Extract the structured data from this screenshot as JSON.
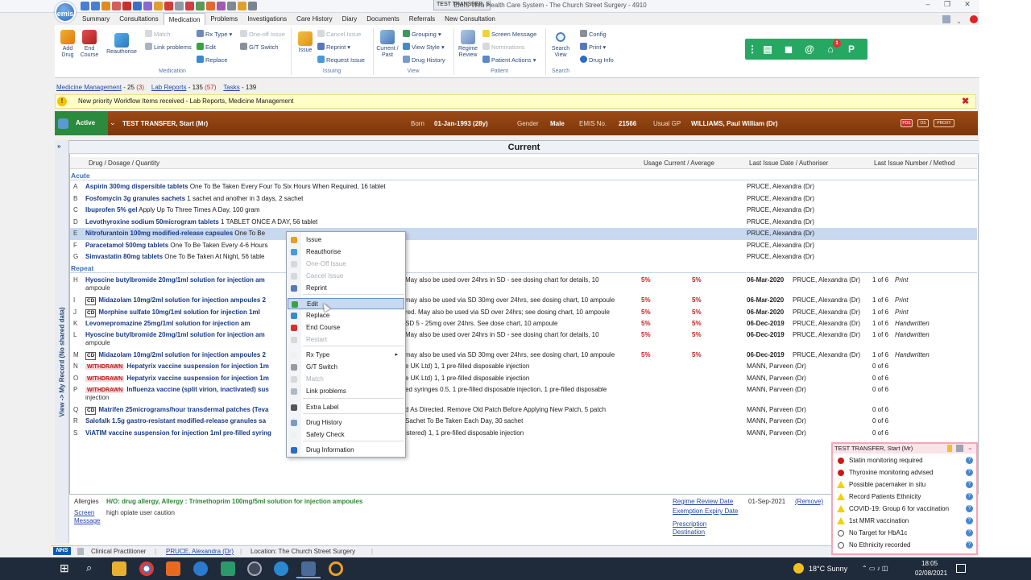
{
  "window": {
    "title": "EMIS Web Health Care System - The Church Street Surgery - 4910",
    "doc_tab": "TEST TRANSFER, St...",
    "logo": "emis",
    "min": "–",
    "max": "❐",
    "close": "✕"
  },
  "ribbon_tabs": [
    "Summary",
    "Consultations",
    "Medication",
    "Problems",
    "Investigations",
    "Care History",
    "Diary",
    "Documents",
    "Referrals",
    "New Consultation"
  ],
  "ribbon": {
    "add_drug": "Add Drug",
    "end_course": "End Course",
    "reauthorise": "Reauthorise",
    "match": "Match",
    "link_problems": "Link problems",
    "rx_type": "Rx Type",
    "edit": "Edit",
    "replace": "Replace",
    "one_off_issue": "One-off Issue",
    "gt_switch": "G/T Switch",
    "group_medication": "Medication",
    "issue": "Issue",
    "cancel_issue": "Cancel Issue",
    "reprint": "Reprint",
    "request_issue": "Request Issue",
    "group_issuing": "Issuing",
    "current_past": "Current / Past",
    "grouping": "Grouping",
    "view_style": "View Style",
    "drug_history": "Drug History",
    "group_view": "View",
    "regime_review": "Regime Review",
    "screen_message": "Screen Message",
    "nominations": "Nominations",
    "patient_actions": "Patient Actions",
    "group_patient": "Patient",
    "search_view": "Search View",
    "config": "Config",
    "print": "Print",
    "drug_info": "Drug Info",
    "group_search": "Search"
  },
  "greenbar": {
    "badge": "1",
    "p": "P"
  },
  "status": {
    "medicine_management": "Medicine Management",
    "mm_count": "- 25",
    "mm_new": "(3)",
    "lab_reports": "Lab Reports",
    "lr_count": "- 135",
    "lr_new": "(57)",
    "tasks": "Tasks",
    "tasks_count": "- 139"
  },
  "notification": {
    "text": "New priority Workflow Items received - Lab Reports, Medicine Management",
    "icon": "!",
    "close": "✖"
  },
  "patient": {
    "status": "Active",
    "name": "TEST TRANSFER, Start (Mr)",
    "born_label": "Born",
    "born": "01-Jan-1993 (28y)",
    "gender_label": "Gender",
    "gender": "Male",
    "emis_label": "EMIS No.",
    "emis_no": "21566",
    "gp_label": "Usual GP",
    "gp": "WILLIAMS, Paul William (Dr)",
    "badges": [
      "PDS",
      "OS",
      "PROXY"
    ]
  },
  "main": {
    "title": "Current",
    "side_label": "View -> My Record (No shared data)",
    "side_arrow": "»",
    "columns": {
      "drug": "Drug / Dosage / Quantity",
      "usage": "Usage Current / Average",
      "last_issue": "Last Issue Date / Authoriser",
      "last_num": "Last Issue Number / Method"
    },
    "sections": {
      "acute": "Acute",
      "repeat": "Repeat"
    },
    "acute": [
      {
        "l": "A",
        "d": "Aspirin 300mg dispersible tablets",
        "s": " One To Be Taken Every Four To Six Hours When Required, 16 tablet",
        "auth": "PRUCE, Alexandra (Dr)"
      },
      {
        "l": "B",
        "d": "Fosfomycin 3g granules sachets",
        "s": " 1 sachet and another in 3 days, 2 sachet",
        "auth": "PRUCE, Alexandra (Dr)"
      },
      {
        "l": "C",
        "d": "Ibuprofen 5% gel",
        "s": " Apply Up To Three Times A Day, 100 gram",
        "auth": "PRUCE, Alexandra (Dr)"
      },
      {
        "l": "D",
        "d": "Levothyroxine sodium 50microgram tablets",
        "s": " 1 TABLET ONCE A DAY, 56 tablet",
        "auth": "PRUCE, Alexandra (Dr)"
      },
      {
        "l": "E",
        "d": "Nitrofurantoin 100mg modified-release capsules",
        "s": " One To Be",
        "auth": "PRUCE, Alexandra (Dr)"
      },
      {
        "l": "F",
        "d": "Paracetamol 500mg tablets",
        "s": " One To Be Taken Every 4-6 Hours",
        "auth": "PRUCE, Alexandra (Dr)"
      },
      {
        "l": "G",
        "d": "Simvastatin 80mg tablets",
        "s": " One To Be Taken At Night, 56 table",
        "auth": "PRUCE, Alexandra (Dr)"
      }
    ],
    "repeat": [
      {
        "l": "H",
        "d": "Hyoscine butylbromide 20mg/1ml solution for injection am",
        "r": "May also be used over 24hrs in SD - see dosing chart for details, 10",
        "cont": "ampoule",
        "u": "5%",
        "a": "5%",
        "date": "06-Mar-2020",
        "auth": "PRUCE, Alexandra (Dr)",
        "num": "1 of 6",
        "meth": "Print"
      },
      {
        "l": "I",
        "cd": "CD",
        "d": "Midazolam 10mg/2ml solution for injection ampoules 2",
        "r": "may also be used via SD 30mg over 24hrs, see dosing chart, 10 ampoule",
        "u": "5%",
        "a": "5%",
        "date": "06-Mar-2020",
        "auth": "PRUCE, Alexandra (Dr)",
        "num": "1 of 6",
        "meth": "Print"
      },
      {
        "l": "J",
        "cd": "CD",
        "d": "Morphine sulfate 10mg/1ml solution for injection 1ml",
        "r": "red. May also be used via SD over 24hrs; see dosing chart, 10 ampoule",
        "u": "5%",
        "a": "5%",
        "date": "06-Mar-2020",
        "auth": "PRUCE, Alexandra (Dr)",
        "num": "1 of 6",
        "meth": "Print"
      },
      {
        "l": "K",
        "d": "Levomepromazine 25mg/1ml solution for injection am",
        "r": "SD 5 - 25mg over 24hrs. See dose chart, 10 ampoule",
        "u": "5%",
        "a": "5%",
        "date": "06-Dec-2019",
        "auth": "PRUCE, Alexandra (Dr)",
        "num": "1 of 6",
        "meth": "Handwritten"
      },
      {
        "l": "L",
        "d": "Hyoscine butylbromide 20mg/1ml solution for injection am",
        "r": "May also be used over 24hrs in SD - see dosing chart for details, 10",
        "cont": "ampoule",
        "u": "5%",
        "a": "5%",
        "date": "06-Dec-2019",
        "auth": "PRUCE, Alexandra (Dr)",
        "num": "1 of 6",
        "meth": "Handwritten"
      },
      {
        "l": "M",
        "cd": "CD",
        "d": "Midazolam 10mg/2ml solution for injection ampoules 2",
        "r": "may also be used via SD 30mg over 24hrs, see dosing chart, 10 ampoule",
        "u": "5%",
        "a": "5%",
        "date": "06-Dec-2019",
        "auth": "PRUCE, Alexandra (Dr)",
        "num": "1 of 6",
        "meth": "Handwritten"
      },
      {
        "l": "N",
        "wd": "WITHDRAWN",
        "d": "Hepatyrix vaccine suspension for injection 1m",
        "r": "e UK Ltd) 1, 1 pre-filled disposable injection",
        "auth": "MANN, Parveen (Dr)",
        "num": "0 of 6"
      },
      {
        "l": "O",
        "wd": "WITHDRAWN",
        "d": "Hepatyrix vaccine suspension for injection 1m",
        "r": "e UK Ltd) 1, 1 pre-filled disposable injection",
        "auth": "MANN, Parveen (Dr)",
        "num": "0 of 6"
      },
      {
        "l": "P",
        "wd": "WITHDRAWN",
        "d": "Influenza vaccine (split virion, inactivated) sus",
        "r": "ed syringes 0.5, 1 pre-filled disposable injection, 1 pre-filled disposable",
        "cont": "injection",
        "auth": "MANN, Parveen (Dr)",
        "num": "0 of 6"
      },
      {
        "l": "Q",
        "cd": "CD",
        "d": "Matrifen 25micrograms/hour transdermal patches (Teva",
        "r": "d As Directed. Remove Old Patch Before Applying New Patch, 5 patch",
        "auth": "MANN, Parveen (Dr)",
        "num": "0 of 6"
      },
      {
        "l": "R",
        "d": "Salofalk 1.5g gastro-resistant modified-release granules sa",
        "r": "Sachet To Be Taken Each Day, 30 sachet",
        "auth": "MANN, Parveen (Dr)",
        "num": "0 of 6"
      },
      {
        "l": "S",
        "d": "ViATIM vaccine suspension for injection 1ml pre-filled syring",
        "r": "istered) 1, 1 pre-filled disposable injection",
        "auth": "MANN, Parveen (Dr)",
        "num": "0 of 6"
      }
    ]
  },
  "context_menu": [
    {
      "label": "Issue",
      "disabled": false,
      "color": "#e8a020"
    },
    {
      "label": "Reauthorise",
      "disabled": false,
      "color": "#4a9ad8"
    },
    {
      "label": "One-Off Issue",
      "disabled": true,
      "color": "#d8d8d8"
    },
    {
      "label": "Cancel Issue",
      "disabled": true,
      "color": "#d8d8d8"
    },
    {
      "label": "Reprint",
      "disabled": false,
      "color": "#5878b8"
    },
    {
      "label": "Edit",
      "disabled": false,
      "color": "#3aa04a",
      "highlight": true
    },
    {
      "label": "Replace",
      "disabled": false,
      "color": "#3a8ad0"
    },
    {
      "label": "End Course",
      "disabled": false,
      "color": "#d83030"
    },
    {
      "label": "Restart",
      "disabled": true,
      "color": "#d8d8d8"
    },
    {
      "label": "Rx Type",
      "disabled": false,
      "color": "#f0f0f0",
      "submenu": "▸"
    },
    {
      "label": "G/T Switch",
      "disabled": false,
      "color": "#9a9a9a"
    },
    {
      "label": "Match",
      "disabled": true,
      "color": "#d8d8d8"
    },
    {
      "label": "Link problems",
      "disabled": false,
      "color": "#b0b8c0"
    },
    {
      "label": "Extra Label",
      "disabled": false,
      "color": "#555555"
    },
    {
      "label": "Drug History",
      "disabled": false,
      "color": "#7a9ac8"
    },
    {
      "label": "Safety Check",
      "disabled": false,
      "color": "#f0f0f0"
    },
    {
      "label": "Drug Information",
      "disabled": false,
      "color": "#2a6dc8"
    }
  ],
  "alerts": {
    "title": "TEST TRANSFER, Start (Mr)",
    "items": [
      {
        "text": "Statin monitoring required",
        "kind": "red"
      },
      {
        "text": "Thyroxine monitoring advised",
        "kind": "red"
      },
      {
        "text": "Possible pacemaker in situ",
        "kind": "warn"
      },
      {
        "text": "Record Patients Ethnicity",
        "kind": "warn"
      },
      {
        "text": "COVID-19: Group 6 for vaccination",
        "kind": "warn"
      },
      {
        "text": "1st MMR vaccination",
        "kind": "warn"
      },
      {
        "text": "No Target for HbA1c",
        "kind": "none"
      },
      {
        "text": "No Ethnicity recorded",
        "kind": "none"
      }
    ],
    "help": "?"
  },
  "bottom": {
    "allergies_label": "Allergies",
    "allergies": "H/O: drug allergy, Allergy : Trimethoprim 100mg/5ml solution for injection ampoules",
    "screen_message_label": "Screen Message",
    "screen_message": "high opiate user caution",
    "regime_review": "Regime Review Date",
    "regime_date": "01-Sep-2021",
    "remove": "(Remove)",
    "exemption": "Exemption Expiry Date",
    "prescription_dest": "Prescription Destination"
  },
  "app_status": {
    "nhs": "NHS",
    "role": "Clinical Practitioner",
    "user": "PRUCE, Alexandra (Dr)",
    "location": "Location: The Church Street Surgery"
  },
  "taskbar": {
    "weather": "18°C Sunny",
    "time": "18:05",
    "date": "02/08/2021",
    "windows": "⊞",
    "search": "⌕"
  }
}
